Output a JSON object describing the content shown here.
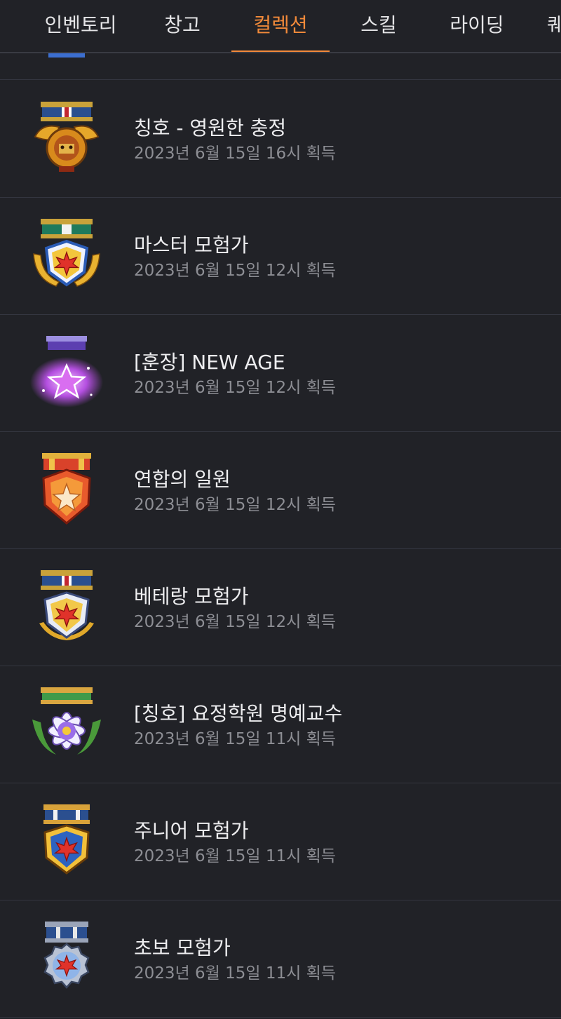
{
  "tabs": [
    {
      "label": "인벤토리",
      "active": false
    },
    {
      "label": "창고",
      "active": false
    },
    {
      "label": "컬렉션",
      "active": true
    },
    {
      "label": "스킬",
      "active": false
    },
    {
      "label": "라이딩",
      "active": false
    },
    {
      "label": "퀘",
      "active": false
    }
  ],
  "accent_color": "#f28a3a",
  "items": [
    {
      "title": "칭호 - 영원한 충정",
      "date": "2023년 6월 15일 16시 획득",
      "icon": "eternal-loyalty-medal-icon"
    },
    {
      "title": "마스터 모험가",
      "date": "2023년 6월 15일 12시 획득",
      "icon": "master-adventurer-medal-icon"
    },
    {
      "title": "[훈장] NEW AGE",
      "date": "2023년 6월 15일 12시 획득",
      "icon": "new-age-medal-icon"
    },
    {
      "title": "연합의 일원",
      "date": "2023년 6월 15일 12시 획득",
      "icon": "union-member-medal-icon"
    },
    {
      "title": "베테랑 모험가",
      "date": "2023년 6월 15일 12시 획득",
      "icon": "veteran-adventurer-medal-icon"
    },
    {
      "title": "[칭호] 요정학원 명예교수",
      "date": "2023년 6월 15일 11시 획득",
      "icon": "fairy-academy-medal-icon"
    },
    {
      "title": "주니어 모험가",
      "date": "2023년 6월 15일 11시 획득",
      "icon": "junior-adventurer-medal-icon"
    },
    {
      "title": "초보 모험가",
      "date": "2023년 6월 15일 11시 획득",
      "icon": "beginner-adventurer-medal-icon"
    }
  ]
}
